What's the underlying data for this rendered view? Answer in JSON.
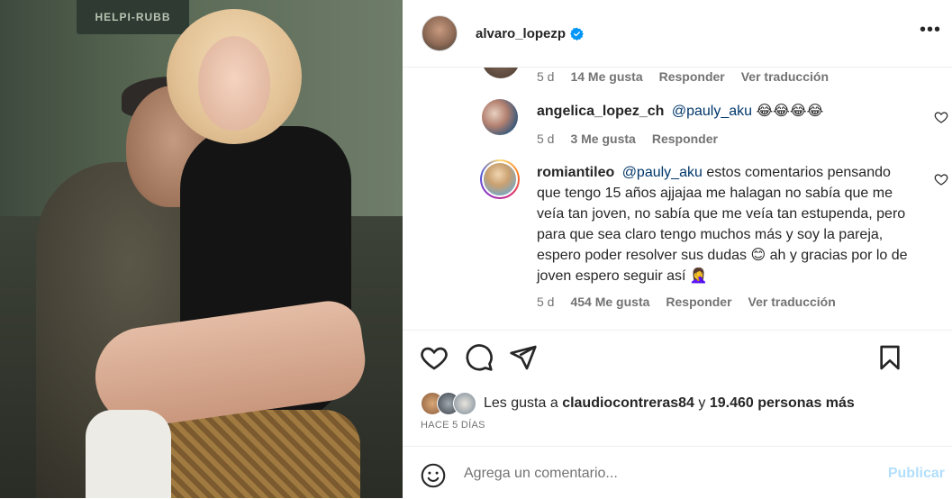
{
  "header": {
    "username": "alvaro_lopezp",
    "more_label": "•••"
  },
  "photo": {
    "sign_text": "HELPI-RUBB"
  },
  "comments": [
    {
      "username": "",
      "text": "",
      "time": "5 d",
      "likes": "14 Me gusta",
      "reply": "Responder",
      "translate": "Ver traducción"
    },
    {
      "username": "angelica_lopez_ch",
      "mention": "@pauly_aku",
      "text": "😂😂😂😂",
      "time": "5 d",
      "likes": "3 Me gusta",
      "reply": "Responder"
    },
    {
      "username": "romiantileo",
      "mention": "@pauly_aku",
      "text": "estos comentarios pensando que tengo 15 años ajjajaa me halagan no sabía que me veía tan joven, no sabía que me veía tan estupenda, pero para que sea claro tengo muchos más y soy la pareja, espero poder resolver sus dudas 😊 ah y gracias por lo de joven espero seguir así 🤦‍♀️",
      "time": "5 d",
      "likes": "454 Me gusta",
      "reply": "Responder",
      "translate": "Ver traducción"
    }
  ],
  "likes": {
    "prefix": "Les gusta a",
    "user": "claudiocontreras84",
    "conj": "y",
    "count": "19.460 personas más"
  },
  "date": "HACE 5 DÍAS",
  "composer": {
    "placeholder": "Agrega un comentario...",
    "publish_label": "Publicar"
  },
  "colors": {
    "verified": "#0095f6",
    "link": "#00376b",
    "publish_disabled": "#b2dffc",
    "secondary_text": "#737373"
  },
  "icons": [
    "verified-badge-icon",
    "more-options-icon",
    "heart-icon",
    "comment-icon",
    "share-icon",
    "save-icon",
    "emoji-icon"
  ]
}
